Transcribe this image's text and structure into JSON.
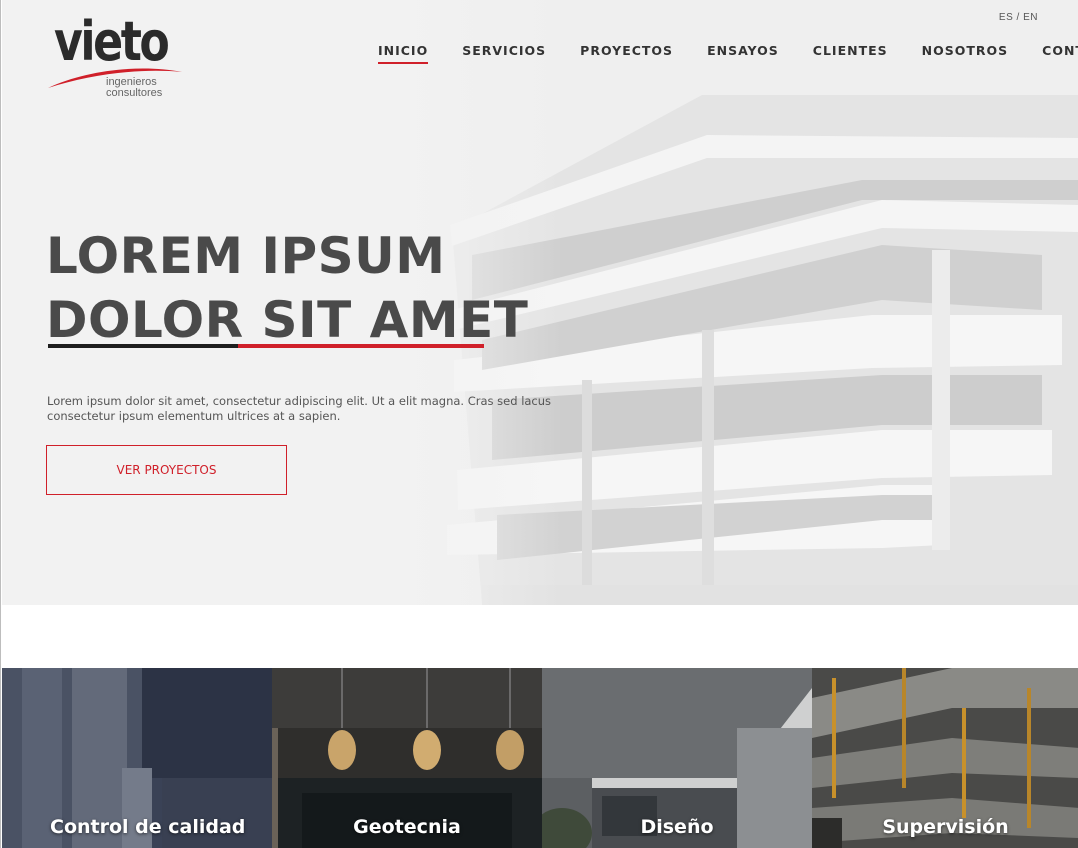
{
  "brand": {
    "name": "vieto",
    "sub_line1": "ingenieros",
    "sub_line2": "consultores",
    "accent_color": "#d0202a"
  },
  "lang_switch": "ES / EN",
  "nav": {
    "items": [
      {
        "label": "INICIO",
        "active": true
      },
      {
        "label": "SERVICIOS",
        "active": false
      },
      {
        "label": "PROYECTOS",
        "active": false
      },
      {
        "label": "ENSAYOS",
        "active": false
      },
      {
        "label": "CLIENTES",
        "active": false
      },
      {
        "label": "NOSOTROS",
        "active": false
      },
      {
        "label": "CONTACTO",
        "active": false
      }
    ]
  },
  "hero": {
    "headline_line1": "LOREM IPSUM",
    "headline_line2": "DOLOR SIT AMET",
    "intro": "Lorem ipsum dolor sit amet, consectetur adipiscing elit. Ut a elit magna. Cras sed lacus consectetur ipsum elementum ultrices at a sapien.",
    "cta_label": "VER PROYECTOS"
  },
  "services": [
    {
      "label": "Control de calidad",
      "icon": "column-photo"
    },
    {
      "label": "Geotecnia",
      "icon": "lamps-photo"
    },
    {
      "label": "Diseño",
      "icon": "modern-house-photo"
    },
    {
      "label": "Supervisión",
      "icon": "construction-photo"
    }
  ]
}
